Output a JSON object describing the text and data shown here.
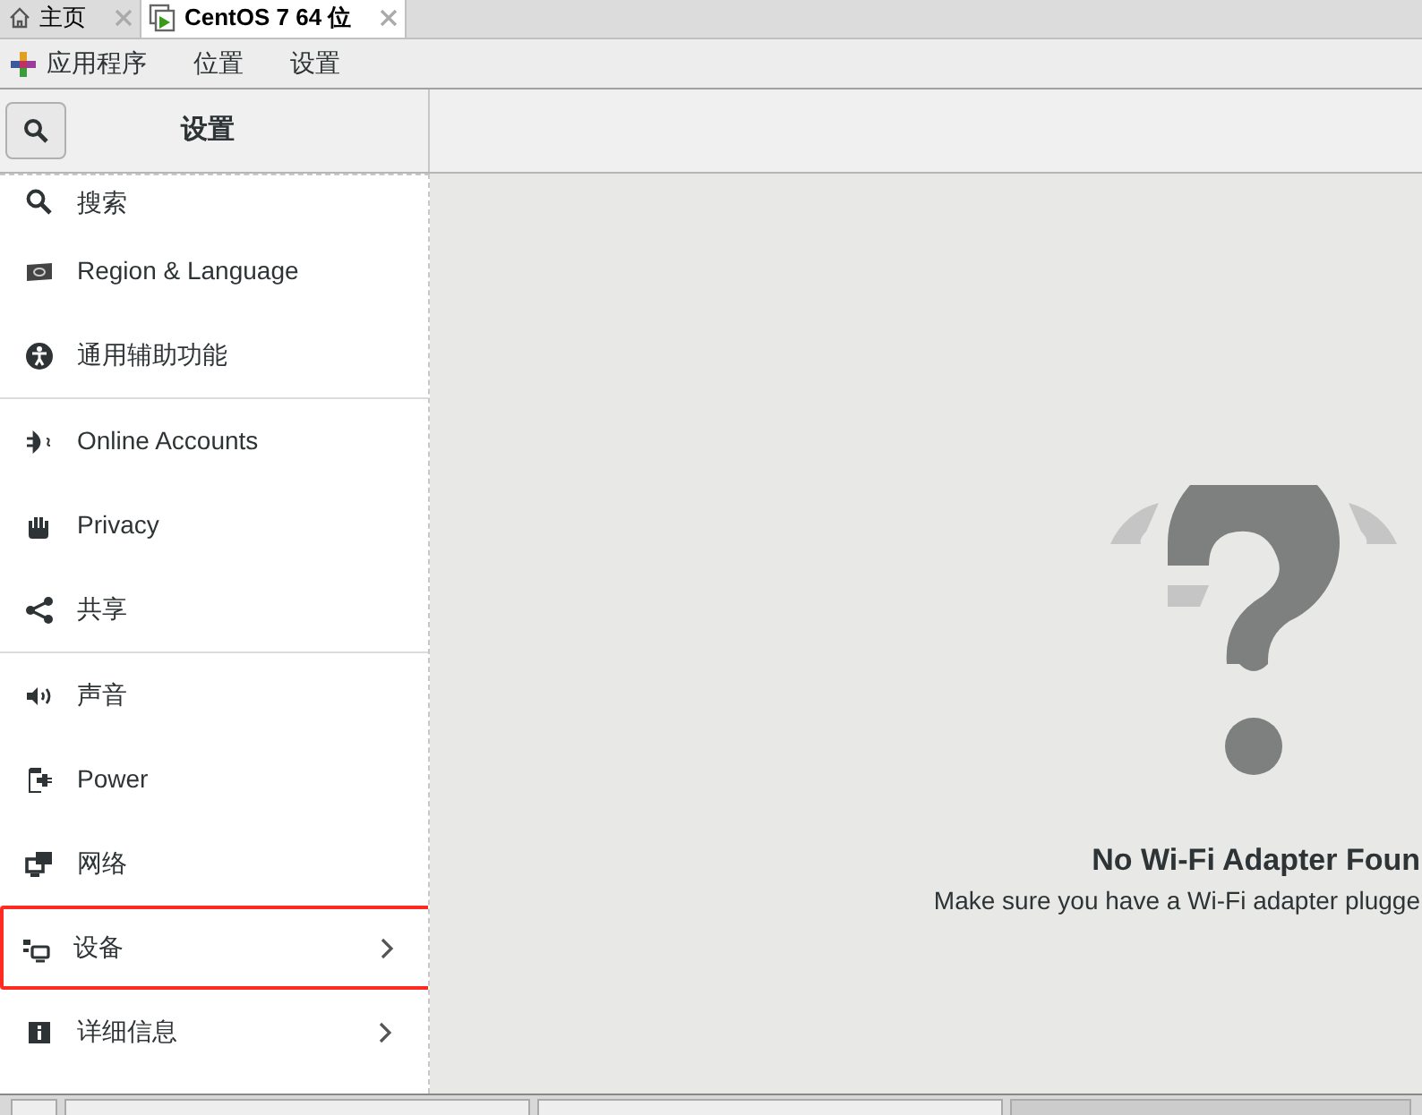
{
  "tabs": [
    {
      "label": "主页",
      "selected": false
    },
    {
      "label": "CentOS 7 64 位",
      "selected": true
    }
  ],
  "menu_bar": [
    "应用程序",
    "位置",
    "设置"
  ],
  "header": {
    "title": "设置"
  },
  "sidebar": {
    "sections": [
      {
        "items": [
          {
            "label": "搜索",
            "arrow": false,
            "highlighted": false
          },
          {
            "label": "Region & Language",
            "arrow": false,
            "highlighted": false
          },
          {
            "label": "通用辅助功能",
            "arrow": false,
            "highlighted": false
          }
        ]
      },
      {
        "items": [
          {
            "label": "Online Accounts",
            "arrow": false,
            "highlighted": false
          },
          {
            "label": "Privacy",
            "arrow": false,
            "highlighted": false
          },
          {
            "label": "共享",
            "arrow": false,
            "highlighted": false
          }
        ]
      },
      {
        "items": [
          {
            "label": "声音",
            "arrow": false,
            "highlighted": false
          },
          {
            "label": "Power",
            "arrow": false,
            "highlighted": false
          },
          {
            "label": "网络",
            "arrow": false,
            "highlighted": false
          },
          {
            "label": "设备",
            "arrow": true,
            "highlighted": true
          },
          {
            "label": "详细信息",
            "arrow": true,
            "highlighted": false
          }
        ]
      }
    ]
  },
  "empty_state": {
    "title": "No Wi-Fi Adapter Foun",
    "message": "Make sure you have a Wi-Fi adapter plugge"
  }
}
